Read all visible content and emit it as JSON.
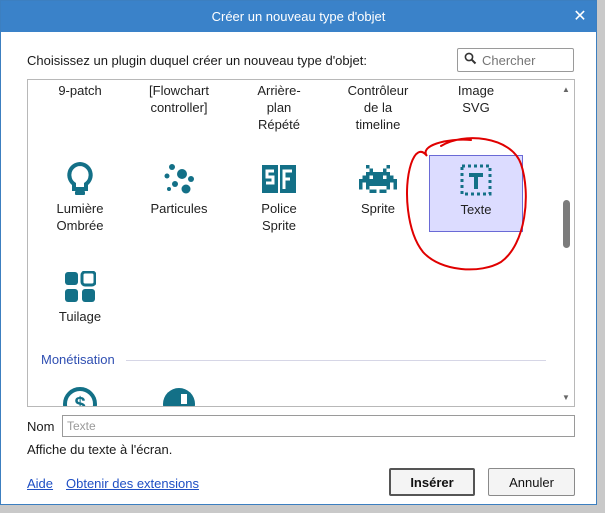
{
  "window": {
    "title": "Créer un nouveau type d'objet",
    "close_label": "✕"
  },
  "prompt": "Choisissez un plugin duquel créer un nouveau type d'objet:",
  "search": {
    "placeholder": "Chercher",
    "value": ""
  },
  "list": {
    "row1": [
      {
        "label": "9-patch"
      },
      {
        "label": "[Flowchart controller]"
      },
      {
        "label": "Arrière-plan Répété"
      },
      {
        "label": "Contrôleur de la timeline"
      },
      {
        "label": "Image SVG"
      }
    ],
    "row2": [
      {
        "label": "Lumière Ombrée",
        "icon": "lightbulb-icon"
      },
      {
        "label": "Particules",
        "icon": "particles-icon"
      },
      {
        "label": "Police Sprite",
        "icon": "sprite-font-icon"
      },
      {
        "label": "Sprite",
        "icon": "space-invader-icon"
      },
      {
        "label": "Texte",
        "icon": "text-icon",
        "selected": true
      }
    ],
    "row3": [
      {
        "label": "Tuilage",
        "icon": "tiles-icon"
      }
    ],
    "section_monetisation": "Monétisation",
    "row4_icons": [
      "dollar-coin-icon",
      "ad-icon"
    ]
  },
  "name_field": {
    "label": "Nom",
    "placeholder": "Texte",
    "value": ""
  },
  "description": "Affiche du texte à l'écran.",
  "links": {
    "help": "Aide",
    "extensions": "Obtenir des extensions"
  },
  "buttons": {
    "insert": "Insérer",
    "cancel": "Annuler"
  },
  "colors": {
    "titlebar": "#3a82c9",
    "icon_teal": "#137087",
    "selection_bg": "#dcdcff",
    "annotation": "#e00000"
  }
}
